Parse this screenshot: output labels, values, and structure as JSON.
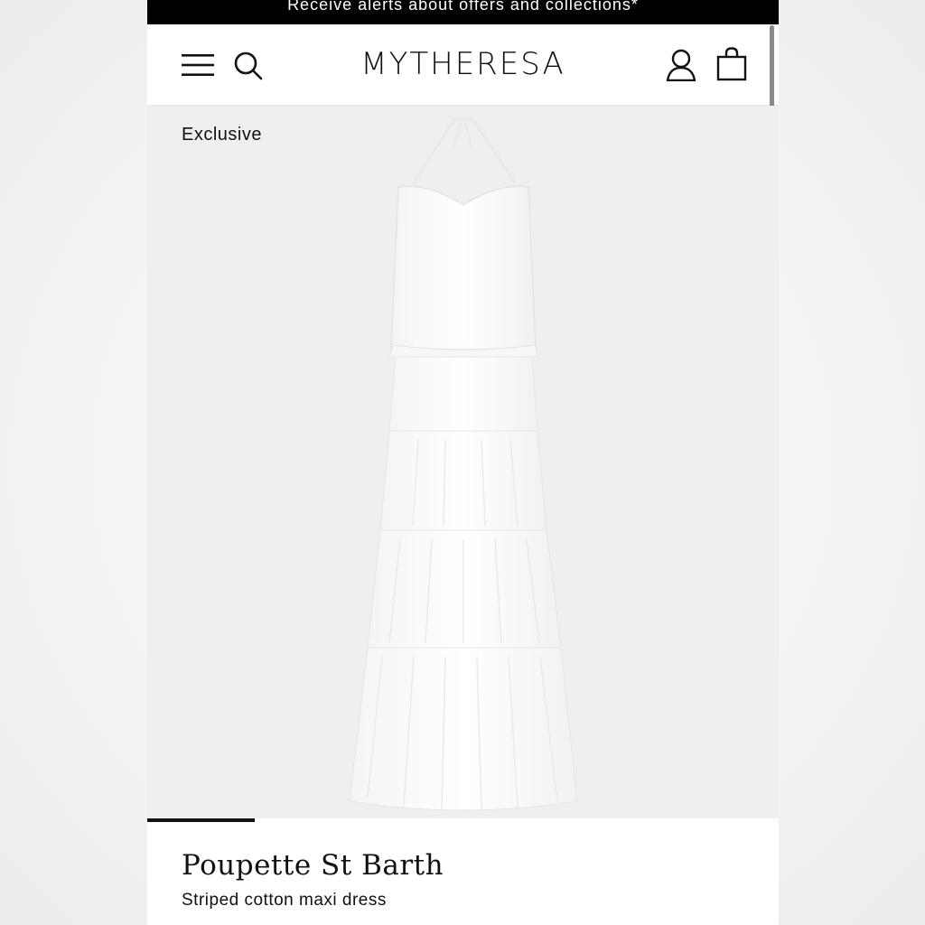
{
  "promo": {
    "text": "Receive alerts about offers and collections*"
  },
  "header": {
    "logo": "MYTHERESA",
    "icons": [
      "menu-icon",
      "search-icon",
      "account-icon",
      "shopping-bag-icon"
    ]
  },
  "gallery": {
    "badge": "Exclusive",
    "image": "white-tiered-maxi-dress",
    "progress_fraction": 0.17
  },
  "product": {
    "brand": "Poupette St Barth",
    "name": "Striped cotton maxi dress"
  },
  "colors": {
    "promo_bg": "#000000",
    "gallery_bg": "#efefef",
    "text": "#111111"
  }
}
